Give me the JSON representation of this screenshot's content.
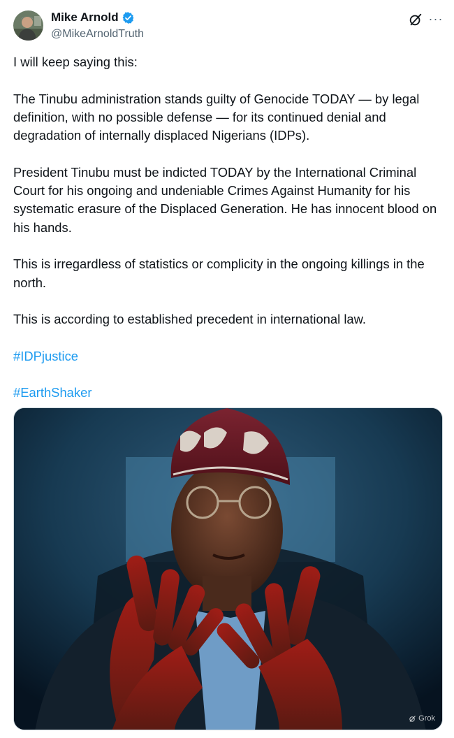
{
  "author": {
    "display_name": "Mike Arnold",
    "handle": "@MikeArnoldTruth",
    "verified_icon": "verified-badge-icon",
    "verified_color": "#1d9bf0"
  },
  "actions": {
    "grok_icon": "grok-icon",
    "more_label": "···"
  },
  "post": {
    "paragraphs": [
      "I will keep saying this:",
      "The Tinubu administration stands guilty of Genocide TODAY — by legal definition, with no possible defense — for its continued denial and degradation of internally displaced Nigerians (IDPs).",
      "President Tinubu must be indicted TODAY by the International Criminal Court for his ongoing and undeniable Crimes Against Humanity for his systematic erasure of the Displaced Generation. He has innocent blood on his hands.",
      "This is irregardless of statistics or complicity in the ongoing killings in the north.",
      "This is according to established precedent in international law."
    ],
    "hashtags": [
      "#IDPjustice",
      "#EarthShaker"
    ],
    "hashtag_color": "#1d9bf0"
  },
  "media": {
    "badge_label": "Grok"
  }
}
